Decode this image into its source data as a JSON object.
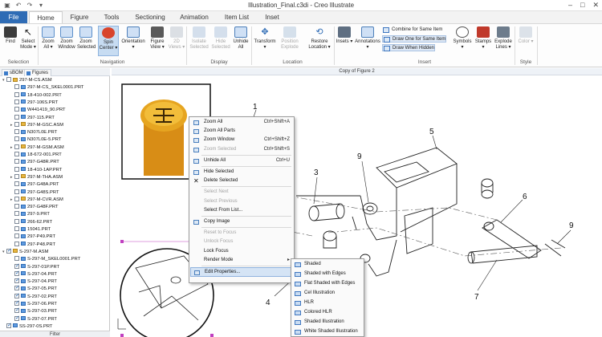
{
  "window": {
    "title": "Illustration_Final.c3di - Creo Illustrate",
    "controls": [
      "–",
      "□",
      "✕"
    ]
  },
  "tabs": [
    "File",
    "Home",
    "Figure",
    "Tools",
    "Sectioning",
    "Animation",
    "Item List",
    "Inset"
  ],
  "ribbon": {
    "selection": {
      "label": "Selection",
      "find": "Find",
      "select_mode": "Select Mode ▾"
    },
    "navigation": {
      "label": "Navigation",
      "zoom_all": "Zoom All ▾",
      "zoom_window": "Zoom Window",
      "zoom_selected": "Zoom Selected",
      "spin_center": "Spin Center ▾",
      "orientation": "Orientation ▾",
      "figure_view": "Figure View ▾",
      "views_2d": "2D Views ▾"
    },
    "display": {
      "label": "Display",
      "isolate": "Isolate Selected",
      "hide": "Hide Selected",
      "unhide": "Unhide All"
    },
    "location": {
      "label": "Location",
      "transform": "Transform ▾",
      "pivot": "Position Explode",
      "restore": "Restore Location ▾"
    },
    "insert": {
      "label": "Insert",
      "insets": "Insets ▾",
      "annotations": "Annotations ▾",
      "combine": "Combine for Same Item",
      "draw_one": "Draw One for Same Item",
      "draw_hidden": "Draw When Hidden",
      "symbols": "Symbols ▾",
      "stamps": "Stamps ▾",
      "explode_lines": "Explode Lines ▾"
    },
    "style": {
      "label": "Style",
      "color": "Color ▾"
    }
  },
  "panel": {
    "tab_sbom": "sBOM",
    "tab_figures": "Figures",
    "filter": "Filter",
    "items": [
      {
        "label": "297-M-CS.ASM",
        "level": 0,
        "exp": "▾",
        "checked": false,
        "type": "asm"
      },
      {
        "label": "297-M-CS_SKEL0001.PRT",
        "level": 1,
        "exp": "",
        "checked": false,
        "type": "prt"
      },
      {
        "label": "18-410-002.PRT",
        "level": 1,
        "exp": "",
        "checked": false,
        "type": "prt"
      },
      {
        "label": "297-106S.PRT",
        "level": 1,
        "exp": "",
        "checked": false,
        "type": "prt"
      },
      {
        "label": "W441419_90.PRT",
        "level": 1,
        "exp": "",
        "checked": false,
        "type": "prt"
      },
      {
        "label": "297-115.PRT",
        "level": 1,
        "exp": "",
        "checked": false,
        "type": "prt"
      },
      {
        "label": "297-M-GSC.ASM",
        "level": 1,
        "exp": "▸",
        "checked": false,
        "type": "asm"
      },
      {
        "label": "N307L0E.PRT",
        "level": 1,
        "exp": "",
        "checked": false,
        "type": "prt"
      },
      {
        "label": "N307L0E-5.PRT",
        "level": 1,
        "exp": "",
        "checked": false,
        "type": "prt"
      },
      {
        "label": "297-M-GSM.ASM",
        "level": 1,
        "exp": "▸",
        "checked": false,
        "type": "asm"
      },
      {
        "label": "18-672-001.PRT",
        "level": 1,
        "exp": "",
        "checked": false,
        "type": "prt"
      },
      {
        "label": "297-G48R.PRT",
        "level": 1,
        "exp": "",
        "checked": false,
        "type": "prt"
      },
      {
        "label": "18-410-1AP.PRT",
        "level": 1,
        "exp": "",
        "checked": false,
        "type": "prt"
      },
      {
        "label": "297-M-THA.ASM",
        "level": 1,
        "exp": "▸",
        "checked": false,
        "type": "asm"
      },
      {
        "label": "297-G48A.PRT",
        "level": 1,
        "exp": "",
        "checked": false,
        "type": "prt"
      },
      {
        "label": "297-G48S.PRT",
        "level": 1,
        "exp": "",
        "checked": false,
        "type": "prt"
      },
      {
        "label": "297-M-CVR.ASM",
        "level": 1,
        "exp": "▸",
        "checked": false,
        "type": "asm"
      },
      {
        "label": "297-G48F.PRT",
        "level": 1,
        "exp": "",
        "checked": false,
        "type": "prt"
      },
      {
        "label": "297-9.PRT",
        "level": 1,
        "exp": "",
        "checked": false,
        "type": "prt"
      },
      {
        "label": "266-62.PRT",
        "level": 1,
        "exp": "",
        "checked": false,
        "type": "prt"
      },
      {
        "label": "15041.PRT",
        "level": 1,
        "exp": "",
        "checked": false,
        "type": "prt"
      },
      {
        "label": "297-P49.PRT",
        "level": 1,
        "exp": "",
        "checked": false,
        "type": "prt"
      },
      {
        "label": "297-P48.PRT",
        "level": 1,
        "exp": "",
        "checked": false,
        "type": "prt"
      },
      {
        "label": "S-297-M.ASM",
        "level": 0,
        "exp": "▾",
        "checked": true,
        "type": "asm"
      },
      {
        "label": "S-297-M_SKEL0001.PRT",
        "level": 1,
        "exp": "",
        "checked": false,
        "type": "prt"
      },
      {
        "label": "S-297-01P.PRT",
        "level": 1,
        "exp": "",
        "checked": true,
        "type": "prt"
      },
      {
        "label": "S-297-04.PRT",
        "level": 1,
        "exp": "",
        "checked": true,
        "type": "prt"
      },
      {
        "label": "S-297-04.PRT",
        "level": 1,
        "exp": "",
        "checked": true,
        "type": "prt"
      },
      {
        "label": "S-297-05.PRT",
        "level": 1,
        "exp": "",
        "checked": true,
        "type": "prt"
      },
      {
        "label": "S-297-02.PRT",
        "level": 1,
        "exp": "",
        "checked": true,
        "type": "prt"
      },
      {
        "label": "S-297-06.PRT",
        "level": 1,
        "exp": "",
        "checked": true,
        "type": "prt"
      },
      {
        "label": "S-297-03.PRT",
        "level": 1,
        "exp": "",
        "checked": true,
        "type": "prt"
      },
      {
        "label": "S-297-07.PRT",
        "level": 1,
        "exp": "",
        "checked": true,
        "type": "prt"
      },
      {
        "label": "SS-297-0S.PRT",
        "level": 0,
        "exp": "",
        "checked": true,
        "type": "prt"
      }
    ]
  },
  "canvas": {
    "title": "Copy of Figure 2",
    "callouts": [
      "1",
      "3",
      "4",
      "5",
      "6",
      "7",
      "9",
      "9"
    ]
  },
  "context_menu": {
    "items": [
      {
        "label": "Zoom All",
        "shortcut": "Ctrl+Shift+A",
        "disabled": false,
        "icon": true
      },
      {
        "label": "Zoom All Parts",
        "shortcut": "",
        "disabled": false,
        "icon": true
      },
      {
        "label": "Zoom Window",
        "shortcut": "Ctrl+Shift+Z",
        "disabled": false,
        "icon": true
      },
      {
        "label": "Zoom Selected",
        "shortcut": "Ctrl+Shift+S",
        "disabled": true,
        "icon": true
      },
      {
        "sep": true
      },
      {
        "label": "Unhide All",
        "shortcut": "Ctrl+U",
        "disabled": false,
        "icon": true
      },
      {
        "sep": true
      },
      {
        "label": "Hide Selected",
        "shortcut": "",
        "disabled": false,
        "icon": true
      },
      {
        "label": "Delete Selected",
        "shortcut": "",
        "disabled": false,
        "icon": "x"
      },
      {
        "sep": true
      },
      {
        "label": "Select Next",
        "shortcut": "",
        "disabled": true,
        "icon": false
      },
      {
        "label": "Select Previous",
        "shortcut": "",
        "disabled": true,
        "icon": false
      },
      {
        "label": "Select From List...",
        "shortcut": "",
        "disabled": false,
        "icon": false
      },
      {
        "sep": true
      },
      {
        "label": "Copy Image",
        "shortcut": "",
        "disabled": false,
        "icon": true
      },
      {
        "sep": true
      },
      {
        "label": "Reset to Focus",
        "shortcut": "",
        "disabled": true,
        "icon": false
      },
      {
        "label": "Unlock Focus",
        "shortcut": "",
        "disabled": true,
        "icon": false
      },
      {
        "label": "Lock Focus",
        "shortcut": "",
        "disabled": false,
        "icon": false
      },
      {
        "label": "Render Mode",
        "shortcut": "",
        "disabled": false,
        "icon": false,
        "submenu": true
      },
      {
        "sep": true
      },
      {
        "label": "Edit Properties...",
        "shortcut": "",
        "disabled": false,
        "icon": true,
        "highlight": true
      }
    ]
  },
  "render_submenu": {
    "items": [
      "Shaded",
      "Shaded with Edges",
      "Flat Shaded with Edges",
      "Cel Illustration",
      "HLR",
      "Colored HLR",
      "Shaded Illustration",
      "White Shaded Illustration"
    ]
  },
  "colors": {
    "file_tab": "#2f6cb5",
    "accent": "#3b7bc9",
    "selection_handles": "#c040c0",
    "knob": "#e6a521"
  }
}
